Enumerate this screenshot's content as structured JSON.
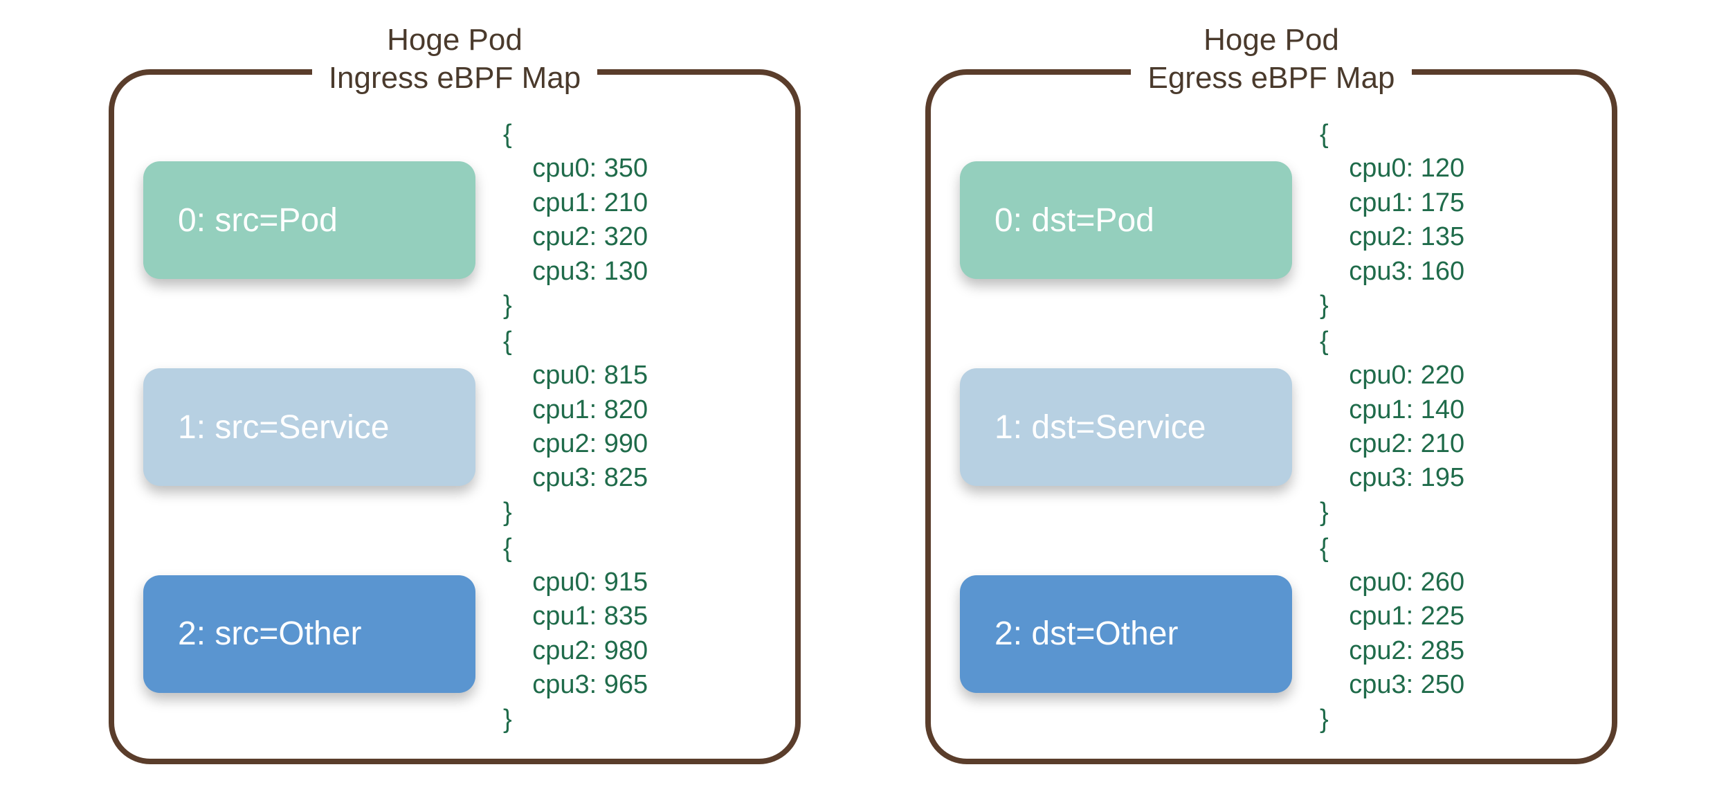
{
  "colors": {
    "border": "#5a3d2b",
    "title_text": "#4a3a2c",
    "value_text": "#1f6b4a",
    "key_text": "#ffffff",
    "key_colors": [
      "#94cfbd",
      "#b7d0e2",
      "#5a95d0"
    ]
  },
  "panels": [
    {
      "title_line1": "Hoge Pod",
      "title_line2": "Ingress eBPF Map",
      "entries": [
        {
          "key_label": "0: src=Pod",
          "color_index": 0,
          "values": {
            "cpu0": 350,
            "cpu1": 210,
            "cpu2": 320,
            "cpu3": 130
          }
        },
        {
          "key_label": "1: src=Service",
          "color_index": 1,
          "values": {
            "cpu0": 815,
            "cpu1": 820,
            "cpu2": 990,
            "cpu3": 825
          }
        },
        {
          "key_label": "2: src=Other",
          "color_index": 2,
          "values": {
            "cpu0": 915,
            "cpu1": 835,
            "cpu2": 980,
            "cpu3": 965
          }
        }
      ]
    },
    {
      "title_line1": "Hoge Pod",
      "title_line2": "Egress eBPF Map",
      "entries": [
        {
          "key_label": "0: dst=Pod",
          "color_index": 0,
          "values": {
            "cpu0": 120,
            "cpu1": 175,
            "cpu2": 135,
            "cpu3": 160
          }
        },
        {
          "key_label": "1: dst=Service",
          "color_index": 1,
          "values": {
            "cpu0": 220,
            "cpu1": 140,
            "cpu2": 210,
            "cpu3": 195
          }
        },
        {
          "key_label": "2: dst=Other",
          "color_index": 2,
          "values": {
            "cpu0": 260,
            "cpu1": 225,
            "cpu2": 285,
            "cpu3": 250
          }
        }
      ]
    }
  ]
}
